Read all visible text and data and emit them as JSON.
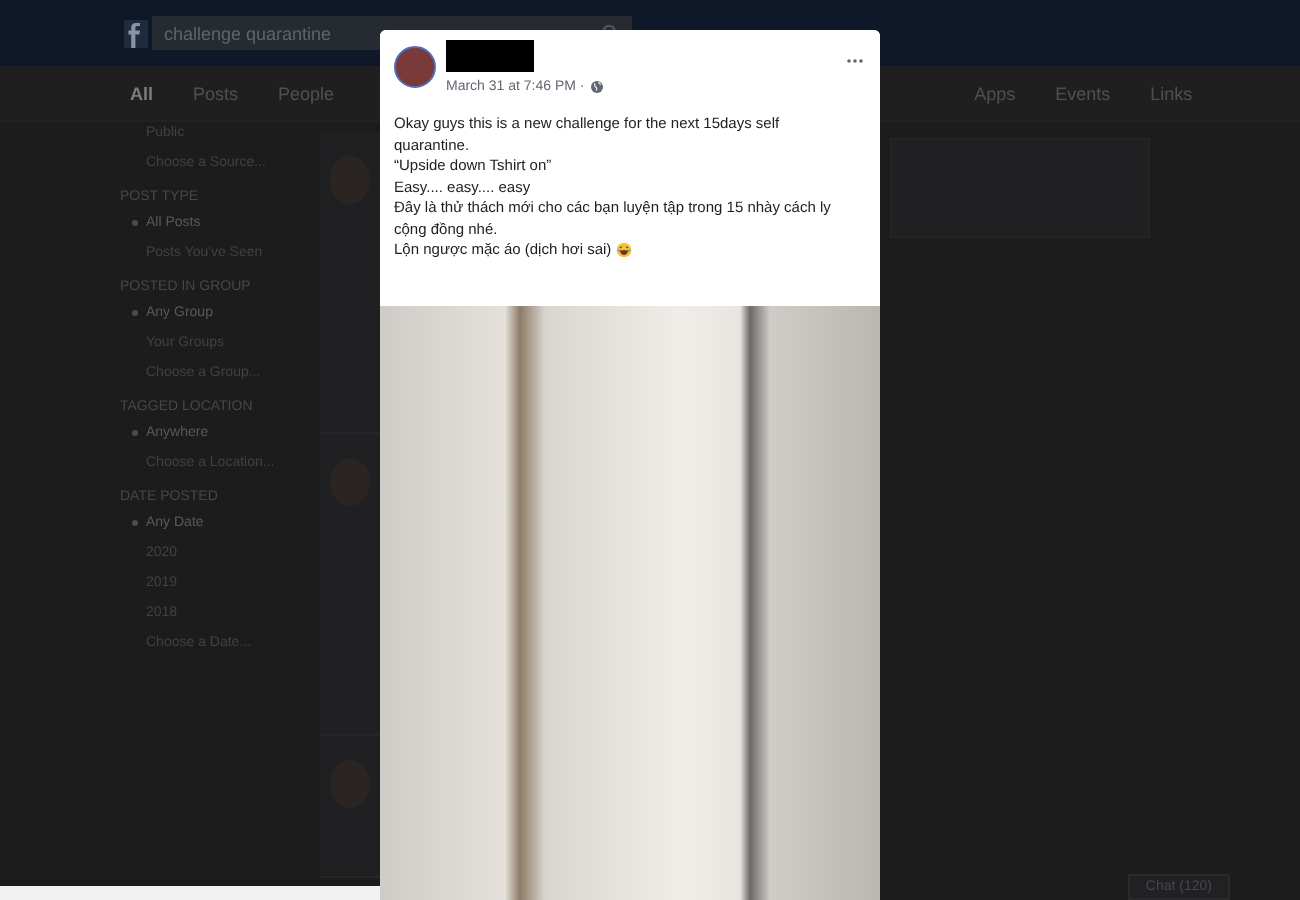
{
  "search": {
    "value": "challenge quarantine"
  },
  "nav_tabs": [
    {
      "label": "All",
      "selected": true
    },
    {
      "label": "Posts",
      "selected": false
    },
    {
      "label": "People",
      "selected": false
    },
    {
      "label": "Apps",
      "selected": false
    },
    {
      "label": "Events",
      "selected": false
    },
    {
      "label": "Links",
      "selected": false
    }
  ],
  "filters": [
    {
      "options": [
        {
          "label": "Public",
          "selected": false
        },
        {
          "label": "Choose a Source...",
          "selected": false
        }
      ]
    },
    {
      "heading": "POST TYPE",
      "options": [
        {
          "label": "All Posts",
          "selected": true
        },
        {
          "label": "Posts You've Seen",
          "selected": false
        }
      ]
    },
    {
      "heading": "POSTED IN GROUP",
      "options": [
        {
          "label": "Any Group",
          "selected": true
        },
        {
          "label": "Your Groups",
          "selected": false
        },
        {
          "label": "Choose a Group...",
          "selected": false
        }
      ]
    },
    {
      "heading": "TAGGED LOCATION",
      "options": [
        {
          "label": "Anywhere",
          "selected": true
        },
        {
          "label": "Choose a Location...",
          "selected": false
        }
      ]
    },
    {
      "heading": "DATE POSTED",
      "options": [
        {
          "label": "Any Date",
          "selected": true
        },
        {
          "label": "2020",
          "selected": false
        },
        {
          "label": "2019",
          "selected": false
        },
        {
          "label": "2018",
          "selected": false
        },
        {
          "label": "Choose a Date...",
          "selected": false
        }
      ]
    }
  ],
  "post": {
    "time": "March 31 at 7:46 PM ·",
    "lines": [
      "Okay guys this is a new challenge for the next 15days self quarantine.",
      "“Upside down Tshirt on”",
      "Easy.... easy.... easy",
      "Đây là thử thách mới cho các bạn luyện tập trong 15 nhày cách ly cộng đồng nhé.",
      "Lộn ngược mặc áo (dịch hơi sai)"
    ]
  },
  "chat": {
    "label": "Chat (120)"
  }
}
